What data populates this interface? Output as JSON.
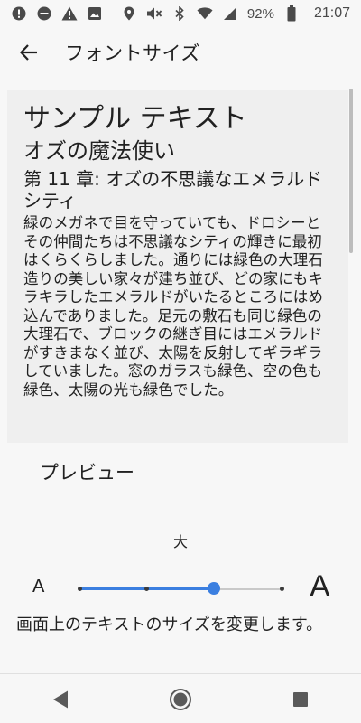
{
  "status_bar": {
    "battery": "92%",
    "time": "21:07",
    "icons": [
      "alert-circle-icon",
      "do-not-disturb-icon",
      "warning-icon",
      "image-icon",
      "location-icon",
      "mute-icon",
      "bluetooth-icon",
      "wifi-icon",
      "signal-icon",
      "battery-icon"
    ]
  },
  "app_bar": {
    "title": "フォントサイズ",
    "back_icon": "back-arrow-icon"
  },
  "sample": {
    "title": "サンプル テキスト",
    "subtitle": "オズの魔法使い",
    "chapter": "第 11 章: オズの不思議なエメラルドシティ",
    "body": "緑のメガネで目を守っていても、ドロシーとその仲間たちは不思議なシティの輝きに最初はくらくらしました。通りには緑色の大理石造りの美しい家々が建ち並び、どの家にもキラキラしたエメラルドがいたるところにはめ込んでありました。足元の敷石も同じ緑色の大理石で、ブロックの継ぎ目にはエメラルドがすきまなく並び、太陽を反射してギラギラしていました。窓のガラスも緑色、空の色も緑色、太陽の光も緑色でした。"
  },
  "preview_label": "プレビュー",
  "slider": {
    "current_value_label": "大",
    "min_label": "A",
    "max_label": "A",
    "steps": 4,
    "selected_index": 2,
    "accent_color": "#3b7fe0"
  },
  "description": "画面上のテキストのサイズを変更します。",
  "nav_bar": {
    "icons": [
      "back-triangle-icon",
      "home-circle-icon",
      "recents-square-icon"
    ]
  }
}
